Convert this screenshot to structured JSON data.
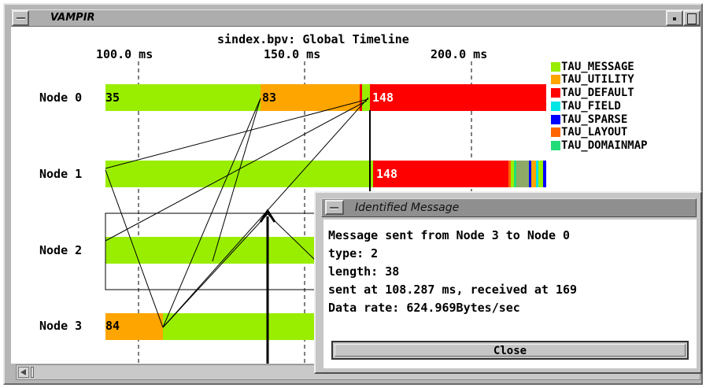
{
  "window": {
    "title": "VAMPIR"
  },
  "timeline": {
    "title": "sindex.bpv: Global Timeline",
    "ticks": [
      "100.0 ms",
      "150.0 ms",
      "200.0 ms"
    ],
    "nodes": [
      {
        "label": "Node 0",
        "start_label": "35"
      },
      {
        "label": "Node 1",
        "start_label": ""
      },
      {
        "label": "Node 2",
        "start_label": ""
      },
      {
        "label": "Node 3",
        "start_label": "84"
      }
    ],
    "bar_labels": {
      "node0_utility": "83",
      "node0_default": "148",
      "node1_default": "148"
    }
  },
  "legend": [
    {
      "label": "TAU_MESSAGE",
      "color": "#99ee00"
    },
    {
      "label": "TAU_UTILITY",
      "color": "#ffa500"
    },
    {
      "label": "TAU_DEFAULT",
      "color": "#ff0000"
    },
    {
      "label": "TAU_FIELD",
      "color": "#00e5e5"
    },
    {
      "label": "TAU_SPARSE",
      "color": "#0000ff"
    },
    {
      "label": "TAU_LAYOUT",
      "color": "#ff6600"
    },
    {
      "label": "TAU_DOMAINMAP",
      "color": "#22dd77"
    }
  ],
  "dialog": {
    "title": "Identified Message",
    "lines": [
      "Message sent from Node 3 to Node 0",
      "type: 2",
      "length: 38",
      "sent at 108.287 ms, received at 169",
      "Data rate: 624.969Bytes/sec"
    ],
    "close_label": "Close"
  }
}
